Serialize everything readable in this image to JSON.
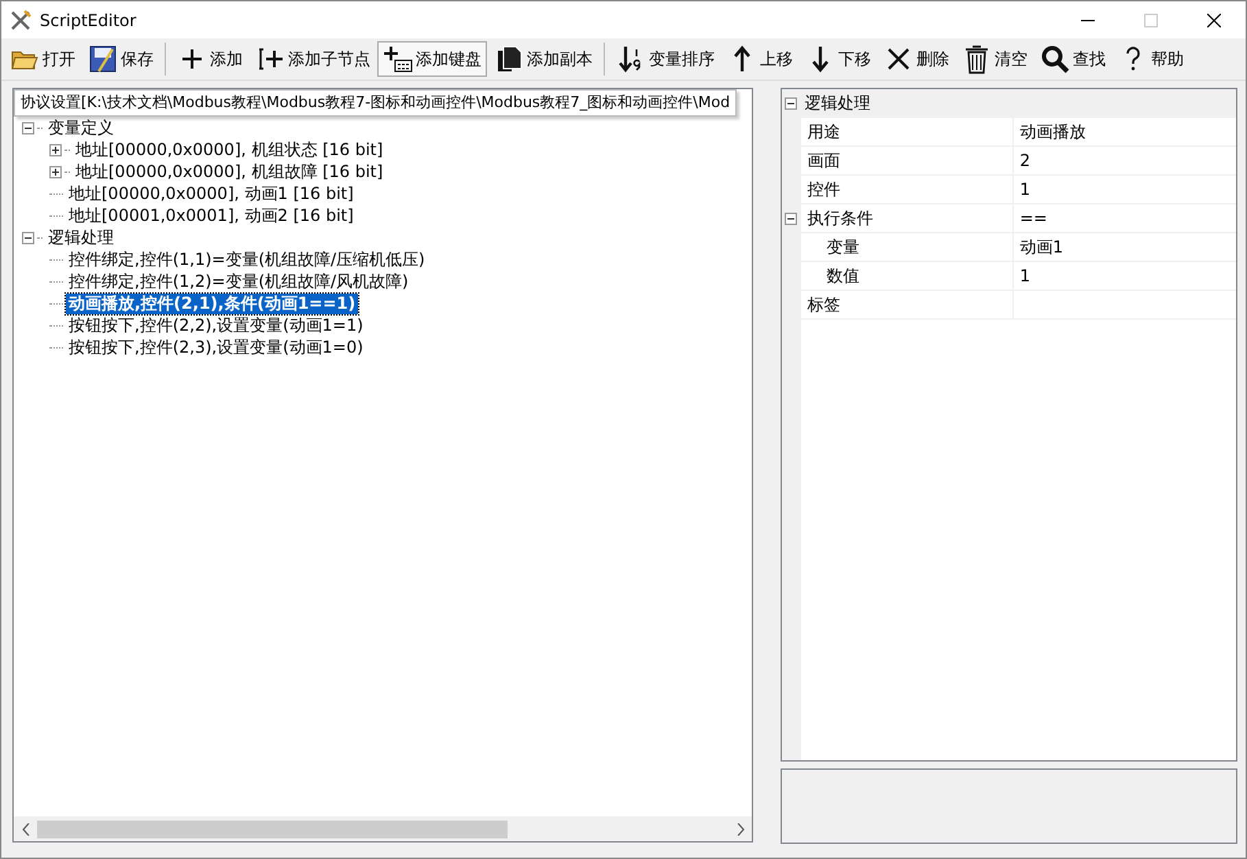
{
  "window": {
    "title": "ScriptEditor",
    "maximize_disabled": true
  },
  "toolbar": {
    "groups": [
      [
        {
          "label": "打开",
          "highlighted": false
        },
        {
          "label": "保存",
          "highlighted": false
        }
      ],
      [
        {
          "label": "添加",
          "highlighted": false
        },
        {
          "label": "添加子节点",
          "highlighted": false
        },
        {
          "label": "添加键盘",
          "highlighted": true
        },
        {
          "label": "添加副本",
          "highlighted": false
        }
      ],
      [
        {
          "label": "变量排序",
          "highlighted": false
        },
        {
          "label": "上移",
          "highlighted": false
        },
        {
          "label": "下移",
          "highlighted": false
        },
        {
          "label": "删除",
          "highlighted": false
        },
        {
          "label": "清空",
          "highlighted": false
        },
        {
          "label": "查找",
          "highlighted": false
        },
        {
          "label": "帮助",
          "highlighted": false
        }
      ]
    ]
  },
  "tree": {
    "tooltip": "协议设置[K:\\技术文档\\Modbus教程\\Modbus教程7-图标和动画控件\\Modbus教程7_图标和动画控件\\Mod",
    "nodes": [
      {
        "label": "变量定义",
        "expanded": true,
        "selected": false,
        "children": [
          {
            "label": "地址[00000,0x0000], 机组状态 [16 bit]",
            "expanded": false,
            "selected": false
          },
          {
            "label": "地址[00000,0x0000], 机组故障 [16 bit]",
            "expanded": false,
            "selected": false
          },
          {
            "label": "地址[00000,0x0000], 动画1 [16 bit]",
            "selected": false
          },
          {
            "label": "地址[00001,0x0001], 动画2 [16 bit]",
            "selected": false
          }
        ]
      },
      {
        "label": "逻辑处理",
        "expanded": true,
        "selected": false,
        "children": [
          {
            "label": "控件绑定,控件(1,1)=变量(机组故障/压缩机低压)",
            "selected": false
          },
          {
            "label": "控件绑定,控件(1,2)=变量(机组故障/风机故障)",
            "selected": false
          },
          {
            "label": "动画播放,控件(2,1),条件(动画1==1)",
            "selected": true
          },
          {
            "label": "按钮按下,控件(2,2),设置变量(动画1=1)",
            "selected": false
          },
          {
            "label": "按钮按下,控件(2,3),设置变量(动画1=0)",
            "selected": false
          }
        ]
      }
    ]
  },
  "properties": {
    "category": "逻辑处理",
    "expanded": true,
    "rows": [
      {
        "name": "用途",
        "value": "动画播放"
      },
      {
        "name": "画面",
        "value": "2"
      },
      {
        "name": "控件",
        "value": "1"
      },
      {
        "name": "执行条件",
        "value": "==",
        "expanded": true,
        "children": [
          {
            "name": "变量",
            "value": "动画1"
          },
          {
            "name": "数值",
            "value": "1"
          }
        ]
      },
      {
        "name": "标签"
      }
    ]
  }
}
